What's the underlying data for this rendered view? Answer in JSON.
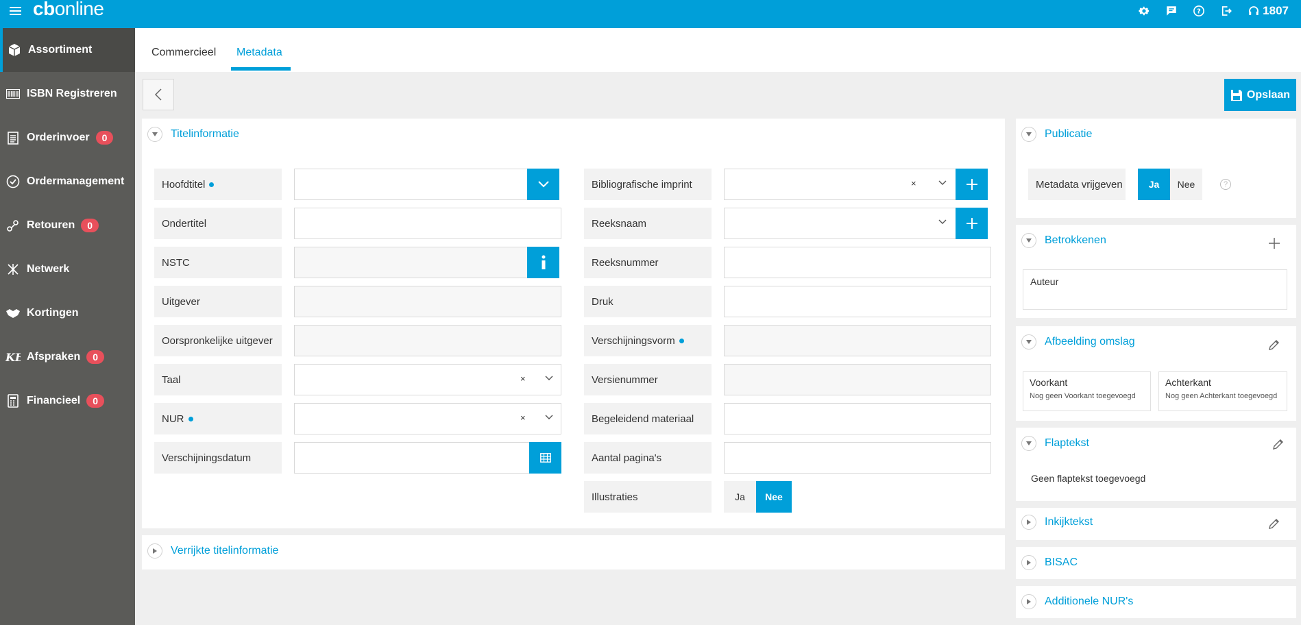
{
  "app": {
    "logo_bold": "cb",
    "logo_rest": "online",
    "user_number": "1807"
  },
  "sidebar": {
    "items": [
      {
        "label": "Assortiment",
        "icon": "box-icon",
        "badge": null
      },
      {
        "label": "ISBN Registreren",
        "icon": "barcode-icon",
        "badge": null
      },
      {
        "label": "Orderinvoer",
        "icon": "clipboard-icon",
        "badge": "0"
      },
      {
        "label": "Ordermanagement",
        "icon": "check-circle-icon",
        "badge": null
      },
      {
        "label": "Retouren",
        "icon": "return-icon",
        "badge": "0"
      },
      {
        "label": "Netwerk",
        "icon": "network-icon",
        "badge": null
      },
      {
        "label": "Kortingen",
        "icon": "handshake-icon",
        "badge": null
      },
      {
        "label": "Afspraken",
        "icon": "kb-icon",
        "badge": "0"
      },
      {
        "label": "Financieel",
        "icon": "calculator-icon",
        "badge": "0"
      }
    ]
  },
  "tabs": [
    {
      "label": "Commercieel",
      "active": false
    },
    {
      "label": "Metadata",
      "active": true
    }
  ],
  "toolbar": {
    "save_label": "Opslaan"
  },
  "titelinformatie": {
    "title": "Titelinformatie",
    "left_fields": [
      {
        "label": "Hoofdtitel",
        "required": true,
        "value": ""
      },
      {
        "label": "Ondertitel",
        "required": false,
        "value": ""
      },
      {
        "label": "NSTC",
        "required": false,
        "value": ""
      },
      {
        "label": "Uitgever",
        "required": false,
        "value": ""
      },
      {
        "label": "Oorspronkelijke uitgever",
        "required": false,
        "value": ""
      },
      {
        "label": "Taal",
        "required": false,
        "value": ""
      },
      {
        "label": "NUR",
        "required": true,
        "value": ""
      },
      {
        "label": "Verschijningsdatum",
        "required": false,
        "value": ""
      }
    ],
    "right_fields": [
      {
        "label": "Bibliografische imprint",
        "required": false,
        "value": ""
      },
      {
        "label": "Reeksnaam",
        "required": false,
        "value": ""
      },
      {
        "label": "Reeksnummer",
        "required": false,
        "value": ""
      },
      {
        "label": "Druk",
        "required": false,
        "value": ""
      },
      {
        "label": "Verschijningsvorm",
        "required": true,
        "value": ""
      },
      {
        "label": "Versienummer",
        "required": false,
        "value": ""
      },
      {
        "label": "Begeleidend materiaal",
        "required": false,
        "value": ""
      },
      {
        "label": "Aantal pagina's",
        "required": false,
        "value": ""
      },
      {
        "label": "Illustraties",
        "required": false,
        "value": ""
      }
    ],
    "clear_symbol": "×",
    "illustraties_options": [
      "Ja",
      "Nee"
    ],
    "illustraties_selected": "Nee"
  },
  "verrijkt": {
    "title": "Verrijkte titelinformatie"
  },
  "publicatie": {
    "title": "Publicatie",
    "metadata_label": "Metadata vrijgeven",
    "options": [
      "Ja",
      "Nee"
    ],
    "selected": "Ja",
    "help": "?"
  },
  "betrokkenen": {
    "title": "Betrokkenen",
    "role": "Auteur"
  },
  "afbeelding": {
    "title": "Afbeelding omslag",
    "front_title": "Voorkant",
    "front_sub": "Nog geen Voorkant toegevoegd",
    "back_title": "Achterkant",
    "back_sub": "Nog geen Achterkant toegevoegd"
  },
  "flaptekst": {
    "title": "Flaptekst",
    "empty": "Geen flaptekst toegevoegd"
  },
  "inkijktekst": {
    "title": "Inkijktekst"
  },
  "bisac": {
    "title": "BISAC"
  },
  "nur": {
    "title": "Additionele NUR's"
  },
  "colors": {
    "accent": "#009fd9",
    "sidebar": "#5b5b58",
    "badge": "#e8505b"
  }
}
